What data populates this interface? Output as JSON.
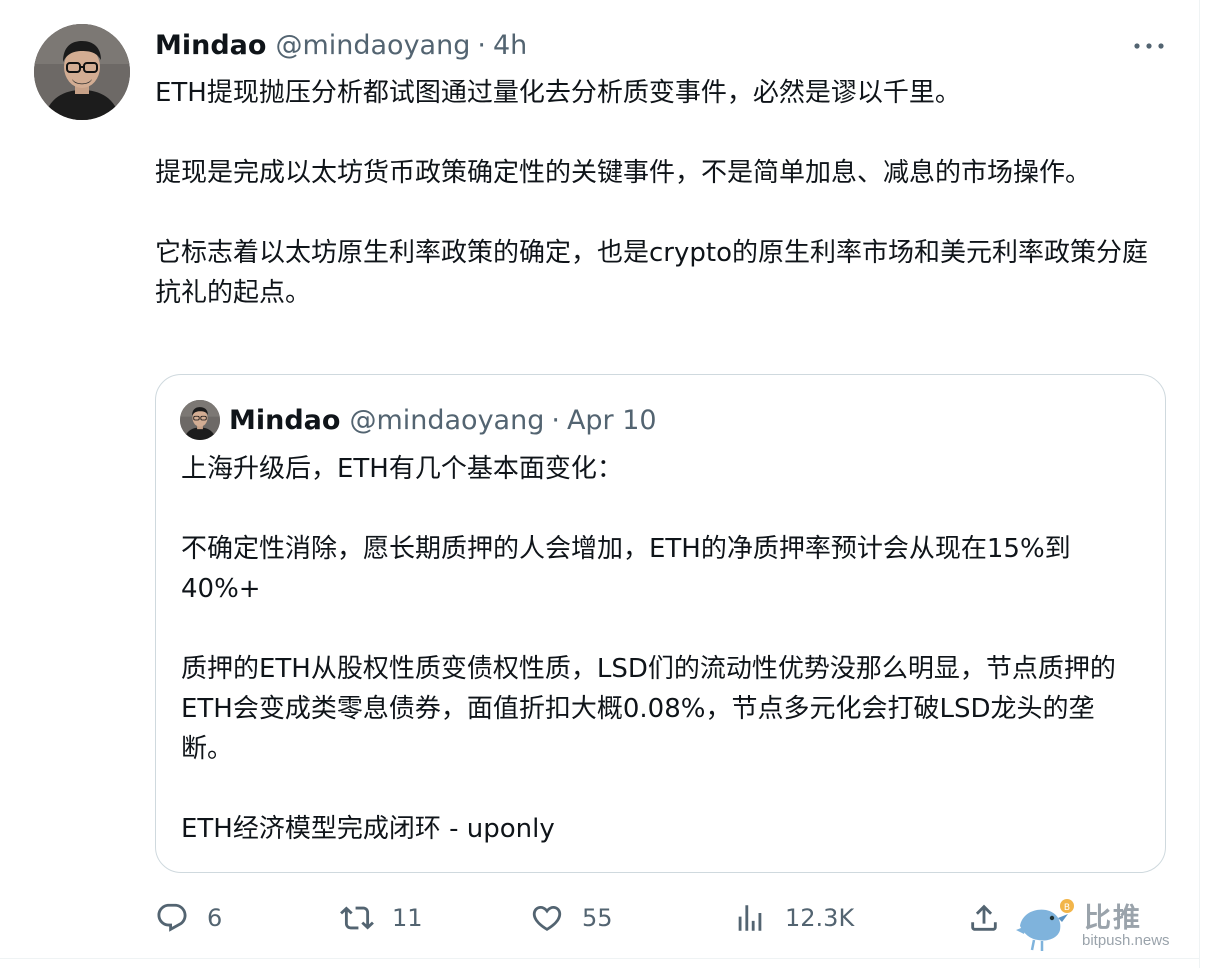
{
  "tweet": {
    "author_name": "Mindao",
    "author_handle": "@mindaoyang",
    "separator": "·",
    "time": "4h",
    "avatar_icon": "user-avatar-photo",
    "more_icon": "more-dots-icon",
    "paragraphs": [
      "ETH提现抛压分析都试图通过量化去分析质变事件，必然是谬以千里。",
      "提现是完成以太坊货币政策确定性的关键事件，不是简单加息、减息的市场操作。",
      "它标志着以太坊原生利率政策的确定，也是crypto的原生利率市场和美元利率政策分庭抗礼的起点。"
    ]
  },
  "quote": {
    "author_name": "Mindao",
    "author_handle": "@mindaoyang",
    "separator": "·",
    "time": "Apr 10",
    "paragraphs": [
      "上海升级后，ETH有几个基本面变化：",
      "不确定性消除，愿长期质押的人会增加，ETH的净质押率预计会从现在15%到40%+",
      "质押的ETH从股权性质变债权性质，LSD们的流动性优势没那么明显，节点质押的ETH会变成类零息债券，面值折扣大概0.08%，节点多元化会打破LSD龙头的垄断。",
      "ETH经济模型完成闭环 - uponly"
    ]
  },
  "actions": {
    "reply": {
      "icon": "reply-icon",
      "count": "6"
    },
    "retweet": {
      "icon": "retweet-icon",
      "count": "11"
    },
    "like": {
      "icon": "heart-icon",
      "count": "55"
    },
    "views": {
      "icon": "views-chart-icon",
      "count": "12.3K"
    },
    "share": {
      "icon": "share-icon"
    }
  },
  "watermark": {
    "logo_text": "比推",
    "site": "bitpush.news"
  },
  "colors": {
    "text_primary": "#0f1419",
    "text_secondary": "#536471",
    "border": "#cfd9de",
    "watermark": "#9aa3ab"
  }
}
